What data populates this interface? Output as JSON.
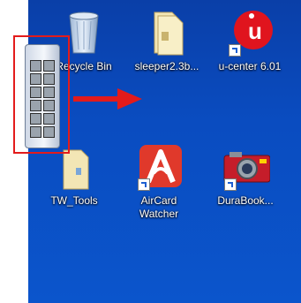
{
  "desktop_icons": [
    {
      "label": "Recycle Bin",
      "icon": "recycle-bin-icon"
    },
    {
      "label": "sleeper2.3b...",
      "icon": "folder-icon"
    },
    {
      "label": "u-center 6.01",
      "icon": "u-center-icon"
    },
    {
      "label": "TW_Tools",
      "icon": "folder-icon"
    },
    {
      "label": "AirCard\nWatcher",
      "icon": "aircard-watcher-icon"
    },
    {
      "label": "DuraBook...",
      "icon": "durabook-camera-icon"
    }
  ],
  "colors": {
    "desktop_background": "#0a4cc0",
    "annotation": "#e31b1b"
  }
}
